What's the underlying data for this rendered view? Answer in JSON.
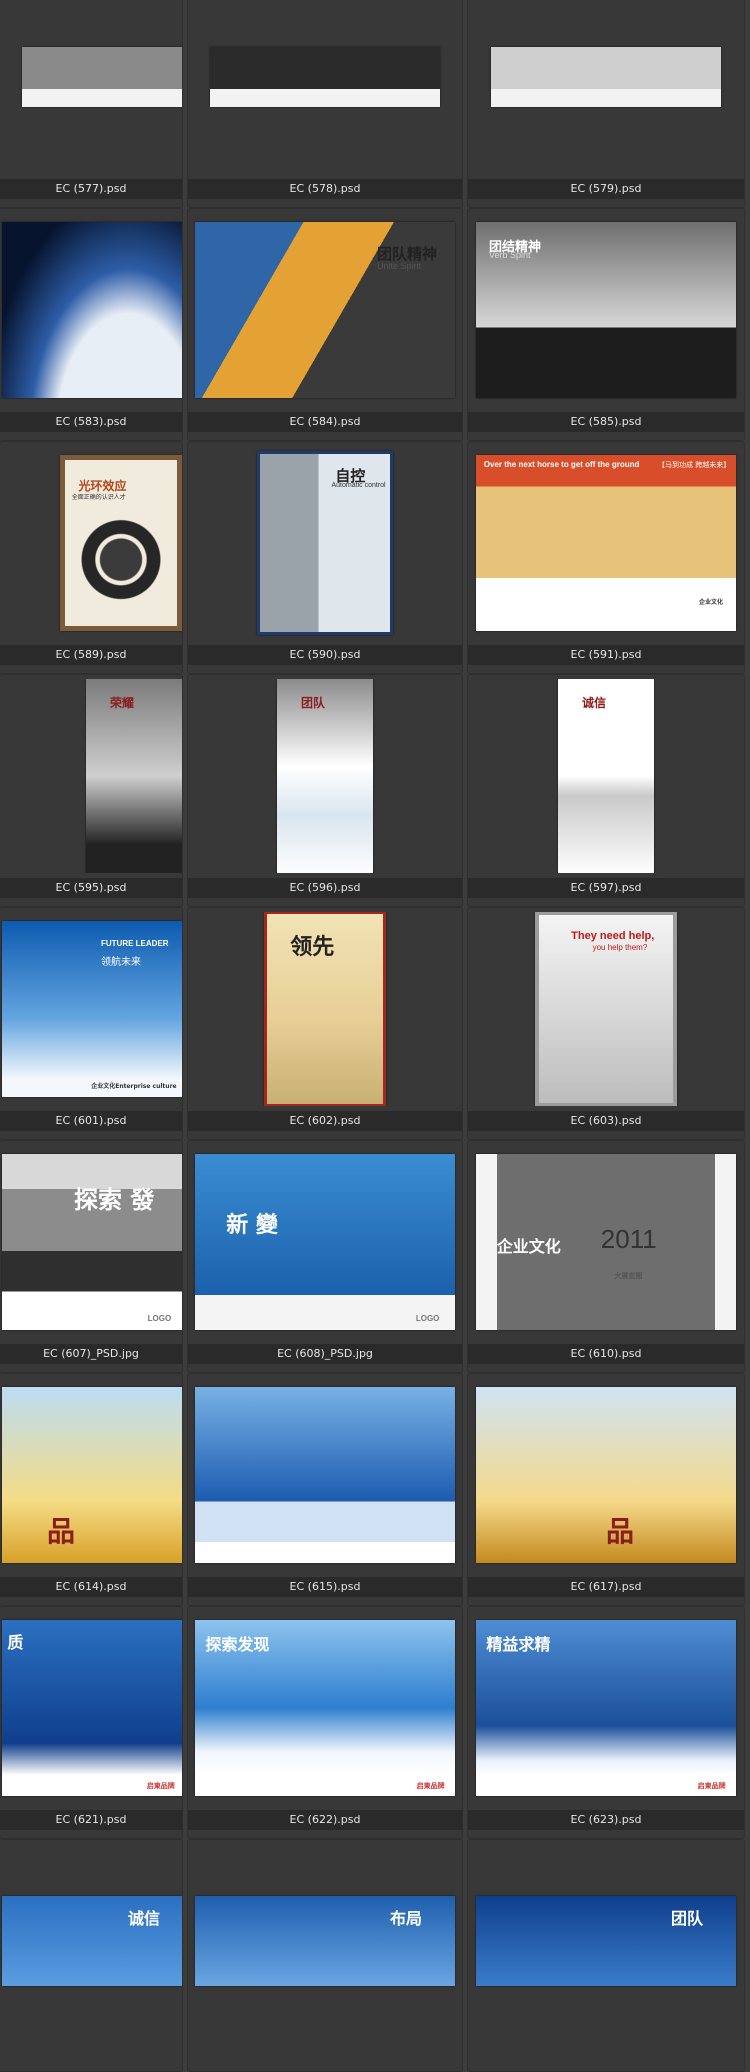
{
  "files": [
    {
      "name": "EC (577).psd",
      "overlay": "",
      "cap": ""
    },
    {
      "name": "EC (578).psd",
      "overlay": "",
      "cap": ""
    },
    {
      "name": "EC (579).psd",
      "overlay": "",
      "cap": ""
    },
    {
      "name": "EC (583).psd",
      "overlay": "",
      "cap": ""
    },
    {
      "name": "EC (584).psd",
      "overlay": "团队精神",
      "cap": "Unite Spirit"
    },
    {
      "name": "EC (585).psd",
      "overlay": "团结精神",
      "cap": "Verb Spirit"
    },
    {
      "name": "EC (589).psd",
      "overlay": "光环效应",
      "cap": "全面正确的认识人才"
    },
    {
      "name": "EC (590).psd",
      "overlay": "自控",
      "cap": "Automatic control"
    },
    {
      "name": "EC (591).psd",
      "overlay": "Over the next horse to get off the ground",
      "cap": "【马到功成 跨越未来】",
      "cap2": "企业文化"
    },
    {
      "name": "EC (595).psd",
      "overlay": "荣耀",
      "cap": ""
    },
    {
      "name": "EC (596).psd",
      "overlay": "团队",
      "cap": ""
    },
    {
      "name": "EC (597).psd",
      "overlay": "诚信",
      "cap": ""
    },
    {
      "name": "EC (601).psd",
      "overlay": "FUTURE LEADER",
      "cap": "领航未来",
      "cap2": "企业文化Enterprise culture"
    },
    {
      "name": "EC (602).psd",
      "overlay": "领先",
      "cap": ""
    },
    {
      "name": "EC (603).psd",
      "overlay": "They need help,",
      "cap": "you help them?"
    },
    {
      "name": "EC (607)_PSD.jpg",
      "overlay": "探索 發",
      "cap": "",
      "cap2": "LOGO"
    },
    {
      "name": "EC (608)_PSD.jpg",
      "overlay": "新 變",
      "cap": "",
      "cap2": "LOGO"
    },
    {
      "name": "EC (610).psd",
      "overlay": "企业文化",
      "cap": "2011",
      "cap2": "大展宏图"
    },
    {
      "name": "EC (614).psd",
      "overlay": "品",
      "cap": ""
    },
    {
      "name": "EC (615).psd",
      "overlay": "",
      "cap": ""
    },
    {
      "name": "EC (617).psd",
      "overlay": "品",
      "cap": ""
    },
    {
      "name": "EC (621).psd",
      "overlay": "质",
      "cap": "",
      "cap2": "启東品牌"
    },
    {
      "name": "EC (622).psd",
      "overlay": "探索发现",
      "cap": "",
      "cap2": "启東品牌"
    },
    {
      "name": "EC (623).psd",
      "overlay": "精益求精",
      "cap": "",
      "cap2": "启東品牌"
    },
    {
      "name": "",
      "overlay": "诚信",
      "cap": ""
    },
    {
      "name": "",
      "overlay": "布局",
      "cap": ""
    },
    {
      "name": "",
      "overlay": "团队",
      "cap": ""
    }
  ]
}
